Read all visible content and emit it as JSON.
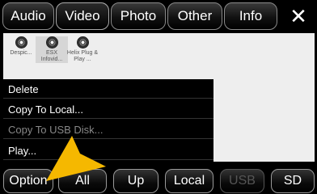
{
  "tabs": [
    {
      "label": "Audio"
    },
    {
      "label": "Video"
    },
    {
      "label": "Photo"
    },
    {
      "label": "Other"
    },
    {
      "label": "Info"
    }
  ],
  "close_label": "✕",
  "files": [
    {
      "name": "Despic..."
    },
    {
      "name": "ESX Infovid..."
    },
    {
      "name": "Helix Plug & Play ..."
    }
  ],
  "menu": [
    {
      "label": "Delete"
    },
    {
      "label": "Copy To Local..."
    },
    {
      "label": "Copy To USB Disk..."
    },
    {
      "label": "Play..."
    }
  ],
  "buttons": [
    {
      "label": "Option"
    },
    {
      "label": "All"
    },
    {
      "label": "Up"
    },
    {
      "label": "Local"
    },
    {
      "label": "USB"
    },
    {
      "label": "SD"
    }
  ],
  "colors": {
    "pointer": "#f5b800"
  }
}
